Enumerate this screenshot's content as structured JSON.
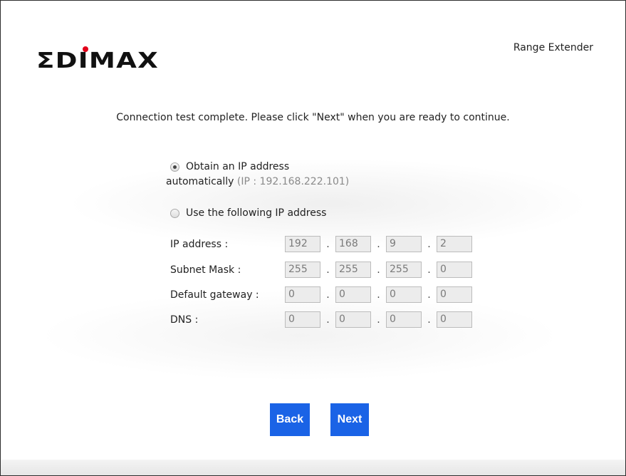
{
  "header": {
    "logo_text": "EDIMAX",
    "product": "Range Extender"
  },
  "message": "Connection test complete. Please click \"Next\" when you are ready to continue.",
  "ip_mode": {
    "auto_label_line1": "Obtain an IP address",
    "auto_label_line2": "automatically",
    "auto_ip": "(IP : 192.168.222.101)",
    "manual_label": "Use the following IP address",
    "selected": "auto"
  },
  "fields": {
    "ip": {
      "label": "IP address :",
      "octets": [
        "192",
        "168",
        "9",
        "2"
      ]
    },
    "mask": {
      "label": "Subnet Mask :",
      "octets": [
        "255",
        "255",
        "255",
        "0"
      ]
    },
    "gateway": {
      "label": "Default gateway :",
      "octets": [
        "0",
        "0",
        "0",
        "0"
      ]
    },
    "dns": {
      "label": "DNS :",
      "octets": [
        "0",
        "0",
        "0",
        "0"
      ]
    },
    "separator": "."
  },
  "buttons": {
    "back": "Back",
    "next": "Next"
  },
  "colors": {
    "button_blue": "#1a63e6",
    "logo_red": "#e2001a",
    "logo_black": "#111111"
  }
}
